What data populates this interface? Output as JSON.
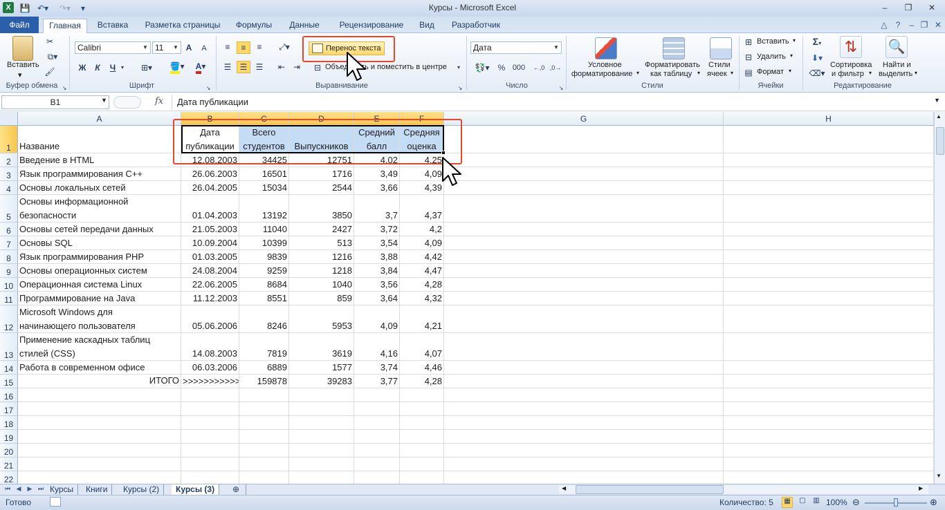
{
  "window": {
    "title": "Курсы  -  Microsoft Excel",
    "min": "‒",
    "restore": "❐",
    "close": "✕"
  },
  "tabs": {
    "file": "Файл",
    "items": [
      "Главная",
      "Вставка",
      "Разметка страницы",
      "Формулы",
      "Данные",
      "Рецензирование",
      "Вид",
      "Разработчик"
    ]
  },
  "ribbon": {
    "clipboard": {
      "paste": "Вставить",
      "group": "Буфер обмена"
    },
    "font": {
      "name": "Calibri",
      "size": "11",
      "bold": "Ж",
      "italic": "К",
      "underline": "Ч",
      "grow": "A",
      "shrink": "A",
      "color_a": "A",
      "group": "Шрифт"
    },
    "alignment": {
      "wrap_text": "Перенос текста",
      "merge_center": "Объединить и поместить в центре",
      "group": "Выравнивание"
    },
    "number": {
      "format": "Дата",
      "percent": "%",
      "thousands": "000",
      "group": "Число"
    },
    "styles": {
      "conditional": [
        "Условное",
        "форматирование"
      ],
      "as_table": [
        "Форматировать",
        "как таблицу"
      ],
      "cell_styles": [
        "Стили",
        "ячеек"
      ],
      "group": "Стили"
    },
    "cells": {
      "insert": "Вставить",
      "delete": "Удалить",
      "format": "Формат",
      "group": "Ячейки"
    },
    "editing": {
      "sum": "Σ",
      "sort": [
        "Сортировка",
        "и фильтр"
      ],
      "find": [
        "Найти и",
        "выделить"
      ],
      "group": "Редактирование"
    }
  },
  "formula_bar": {
    "name_box": "B1",
    "fx": "fx",
    "content": "Дата публикации"
  },
  "sheet": {
    "columns": [
      "A",
      "B",
      "C",
      "D",
      "E",
      "F",
      "G",
      "H"
    ],
    "header_row": {
      "row": "1",
      "a": "Название",
      "b": [
        "Дата",
        "публикации"
      ],
      "c": [
        "Всего",
        "студентов"
      ],
      "d": "Выпускников",
      "e": [
        "Средний",
        "балл"
      ],
      "f": [
        "Средняя",
        "оценка"
      ]
    },
    "rows": [
      {
        "n": "2",
        "a": [
          "Введение в HTML"
        ],
        "b": "12.08.2003",
        "c": "34425",
        "d": "12751",
        "e": "4,02",
        "f": "4,25"
      },
      {
        "n": "3",
        "a": [
          "Язык программирования С++"
        ],
        "b": "26.06.2003",
        "c": "16501",
        "d": "1716",
        "e": "3,49",
        "f": "4,09"
      },
      {
        "n": "4",
        "a": [
          "Основы локальных сетей"
        ],
        "b": "26.04.2005",
        "c": "15034",
        "d": "2544",
        "e": "3,66",
        "f": "4,39"
      },
      {
        "n": "5",
        "a": [
          "Основы информационной",
          "безопасности"
        ],
        "b": "01.04.2003",
        "c": "13192",
        "d": "3850",
        "e": "3,7",
        "f": "4,37"
      },
      {
        "n": "6",
        "a": [
          "Основы сетей передачи данных"
        ],
        "b": "21.05.2003",
        "c": "11040",
        "d": "2427",
        "e": "3,72",
        "f": "4,2"
      },
      {
        "n": "7",
        "a": [
          "Основы SQL"
        ],
        "b": "10.09.2004",
        "c": "10399",
        "d": "513",
        "e": "3,54",
        "f": "4,09"
      },
      {
        "n": "8",
        "a": [
          "Язык программирования PHP"
        ],
        "b": "01.03.2005",
        "c": "9839",
        "d": "1216",
        "e": "3,88",
        "f": "4,42"
      },
      {
        "n": "9",
        "a": [
          "Основы операционных систем"
        ],
        "b": "24.08.2004",
        "c": "9259",
        "d": "1218",
        "e": "3,84",
        "f": "4,47"
      },
      {
        "n": "10",
        "a": [
          "Операционная система Linux"
        ],
        "b": "22.06.2005",
        "c": "8684",
        "d": "1040",
        "e": "3,56",
        "f": "4,28"
      },
      {
        "n": "11",
        "a": [
          "Программирование на Java"
        ],
        "b": "11.12.2003",
        "c": "8551",
        "d": "859",
        "e": "3,64",
        "f": "4,32"
      },
      {
        "n": "12",
        "a": [
          "Microsoft Windows для",
          "начинающего пользователя"
        ],
        "b": "05.06.2006",
        "c": "8246",
        "d": "5953",
        "e": "4,09",
        "f": "4,21"
      },
      {
        "n": "13",
        "a": [
          "Применение каскадных таблиц",
          "стилей (CSS)"
        ],
        "b": "14.08.2003",
        "c": "7819",
        "d": "3619",
        "e": "4,16",
        "f": "4,07"
      },
      {
        "n": "14",
        "a": [
          "Работа в современном офисе"
        ],
        "b": "06.03.2006",
        "c": "6889",
        "d": "1577",
        "e": "3,74",
        "f": "4,46"
      },
      {
        "n": "15",
        "a_right": "ИТОГО",
        "b": ">>>>>>>>>>>",
        "c": "159878",
        "d": "39283",
        "e": "3,77",
        "f": "4,28"
      }
    ],
    "empty_rows": [
      "16",
      "17",
      "18",
      "19",
      "20",
      "21",
      "22"
    ]
  },
  "sheet_tabs": [
    "Курсы",
    "Книги",
    "Курсы (2)",
    "Курсы (3)"
  ],
  "status": {
    "ready": "Готово",
    "count": "Количество: 5",
    "zoom": "100%"
  },
  "colors": {
    "file_tab": "#2a5ea8",
    "selection_header": "#f8c54c",
    "highlight_fill": "#c5dcf5",
    "annotation_red": "#e8472b",
    "wrap_button": "#ffd86a"
  }
}
